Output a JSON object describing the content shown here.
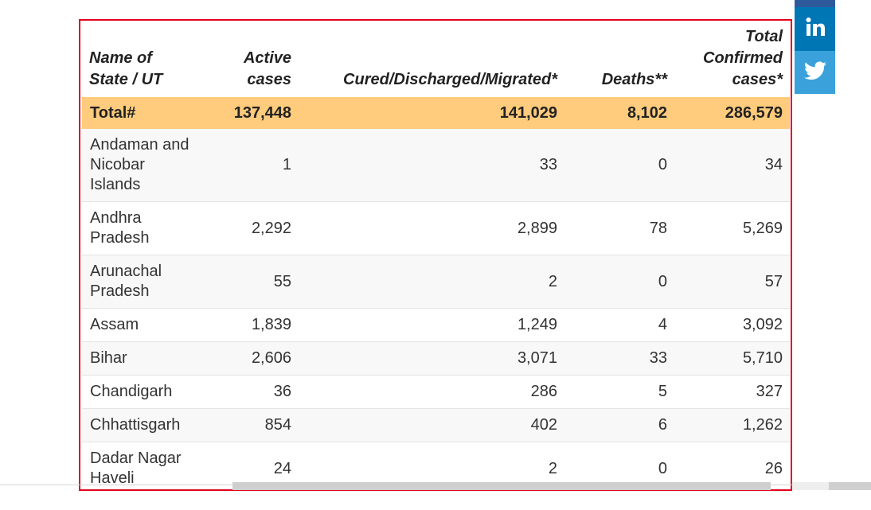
{
  "table": {
    "headers": [
      "Name of State / UT",
      "Active cases",
      "Cured/Discharged/Migrated*",
      "Deaths**",
      "Total Confirmed cases*"
    ],
    "total": {
      "name": "Total#",
      "active": "137,448",
      "cured": "141,029",
      "deaths": "8,102",
      "confirmed": "286,579"
    },
    "rows": [
      {
        "name": "Andaman and Nicobar Islands",
        "active": "1",
        "cured": "33",
        "deaths": "0",
        "confirmed": "34"
      },
      {
        "name": "Andhra Pradesh",
        "active": "2,292",
        "cured": "2,899",
        "deaths": "78",
        "confirmed": "5,269"
      },
      {
        "name": "Arunachal Pradesh",
        "active": "55",
        "cured": "2",
        "deaths": "0",
        "confirmed": "57"
      },
      {
        "name": "Assam",
        "active": "1,839",
        "cured": "1,249",
        "deaths": "4",
        "confirmed": "3,092"
      },
      {
        "name": "Bihar",
        "active": "2,606",
        "cured": "3,071",
        "deaths": "33",
        "confirmed": "5,710"
      },
      {
        "name": "Chandigarh",
        "active": "36",
        "cured": "286",
        "deaths": "5",
        "confirmed": "327"
      },
      {
        "name": "Chhattisgarh",
        "active": "854",
        "cured": "402",
        "deaths": "6",
        "confirmed": "1,262"
      },
      {
        "name": "Dadar Nagar Haveli",
        "active": "24",
        "cured": "2",
        "deaths": "0",
        "confirmed": "26"
      }
    ]
  },
  "social": {
    "linkedin_icon": "linkedin-icon",
    "twitter_icon": "twitter-icon",
    "linkedin_color": "#0077b5",
    "twitter_color": "#3aa1db"
  },
  "colors": {
    "frame_border": "#e3001b",
    "total_row_bg": "#ffcb7c"
  }
}
